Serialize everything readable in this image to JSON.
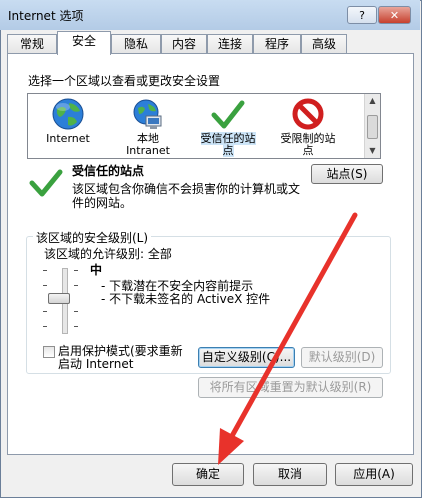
{
  "title": "Internet 选项",
  "title_buttons": {
    "help": "?",
    "close": "✕"
  },
  "tabs": [
    "常规",
    "安全",
    "隐私",
    "内容",
    "连接",
    "程序",
    "高级"
  ],
  "zone_prompt": "选择一个区域以查看或更改安全设置",
  "zones": [
    {
      "label": "Internet",
      "icon": "globe-icon"
    },
    {
      "label": "本地\nIntranet",
      "icon": "intranet-icon"
    },
    {
      "label": "受信任的站\n点",
      "icon": "checkmark-icon"
    },
    {
      "label": "受限制的站\n点",
      "icon": "restricted-icon"
    }
  ],
  "zone_info": {
    "title": "受信任的站点",
    "description": "该区域包含你确信不会损害你的计算机或文\n件的网站。",
    "sites_button": "站点(S)"
  },
  "security": {
    "group_label": "该区域的安全级别(L)",
    "allowed_levels": "该区域的允许级别: 全部",
    "level": "中",
    "bullets": [
      "- 下载潜在不安全内容前提示",
      "- 不下载未签名的 ActiveX 控件"
    ],
    "protected_mode_label": "启用保护模式(要求重新\n启动 Internet",
    "protected_mode_checked": false,
    "custom_button": "自定义级别(C)...",
    "default_button": "默认级别(D)",
    "reset_all_button": "将所有区域重置为默认级别(R)"
  },
  "footer": {
    "ok": "确定",
    "cancel": "取消",
    "apply": "应用(A)"
  },
  "colors": {
    "annotation_arrow": "#e8322b",
    "title_bar": "#c8dcf1"
  }
}
